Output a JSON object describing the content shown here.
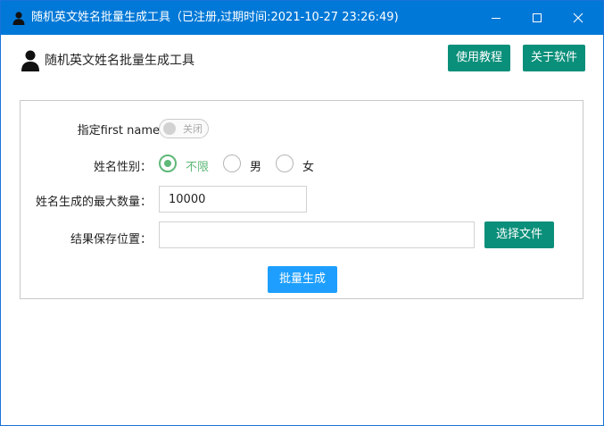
{
  "window": {
    "title": "随机英文姓名批量生成工具（已注册,过期时间:2021-10-27 23:26:49)",
    "minimize_icon": "minimize-icon",
    "maximize_icon": "maximize-icon",
    "close_icon": "close-icon"
  },
  "header": {
    "app_name": "随机英文姓名批量生成工具",
    "tutorial_button": "使用教程",
    "about_button": "关于软件"
  },
  "form": {
    "first_name_label": "指定first name：",
    "first_name_toggle_text": "关闭",
    "first_name_enabled": false,
    "gender_label": "姓名性别：",
    "gender_options": [
      "不限",
      "男",
      "女"
    ],
    "gender_selected": "不限",
    "max_count_label": "姓名生成的最大数量：",
    "max_count_value": "10000",
    "save_path_label": "结果保存位置：",
    "save_path_value": "",
    "choose_file_button": "选择文件",
    "generate_button": "批量生成"
  },
  "colors": {
    "titlebar": "#0078d7",
    "primary_green": "#0a8f7a",
    "primary_blue": "#1e9fff",
    "radio_checked": "#5fb878"
  }
}
